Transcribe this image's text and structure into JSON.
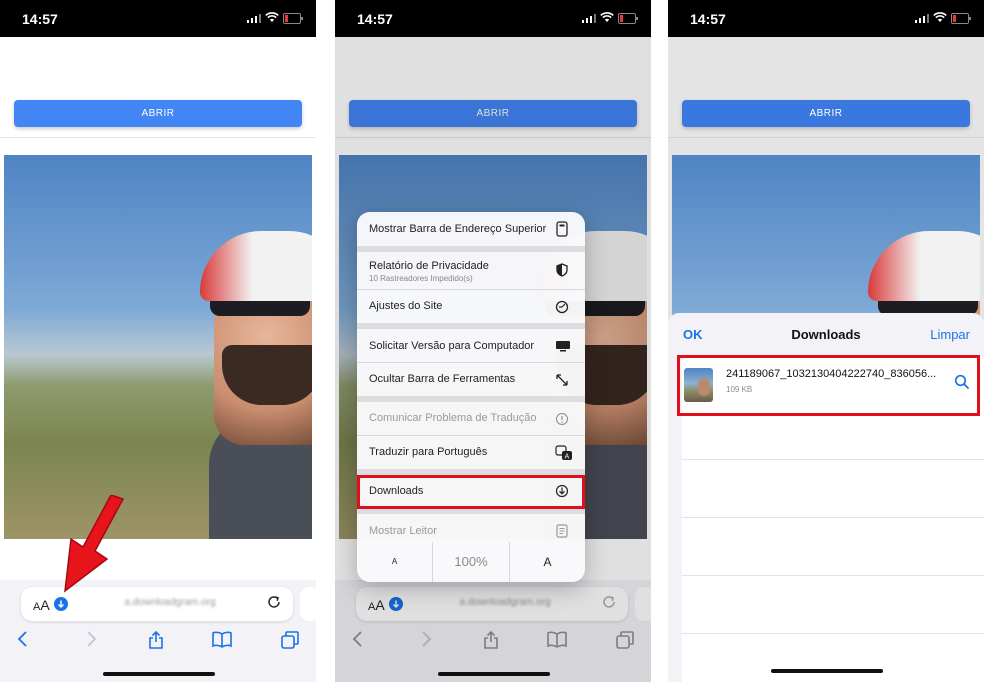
{
  "status": {
    "time": "14:57"
  },
  "page": {
    "open_button": "ABRIR"
  },
  "browser": {
    "text_size_small": "A",
    "text_size_large": "A",
    "url": "a.downloadgram.org"
  },
  "menu": {
    "items": [
      {
        "label": "Mostrar Barra de Endereço Superior",
        "icon": "top-address-bar-icon"
      },
      {
        "label": "Relatório de Privacidade",
        "sublabel": "10 Rastreadores Impedido(s)",
        "icon": "shield-icon"
      },
      {
        "label": "Ajustes do Site",
        "icon": "site-settings-icon"
      },
      {
        "label": "Solicitar Versão para Computador",
        "icon": "desktop-icon"
      },
      {
        "label": "Ocultar Barra de Ferramentas",
        "icon": "arrows-expand-icon"
      },
      {
        "label": "Comunicar Problema de Tradução",
        "icon": "exclamation-icon",
        "disabled": true
      },
      {
        "label": "Traduzir para Português",
        "icon": "translate-icon"
      },
      {
        "label": "Downloads",
        "icon": "download-icon",
        "highlighted": true
      },
      {
        "label": "Mostrar Leitor",
        "icon": "reader-icon",
        "disabled": true
      }
    ],
    "font_small": "A",
    "zoom": "100%",
    "font_large": "A"
  },
  "downloads": {
    "ok": "OK",
    "title": "Downloads",
    "clear": "Limpar",
    "file_name": "241189067_1032130404222740_836056...",
    "file_size": "109 KB"
  },
  "colors": {
    "accent": "#1a73e8",
    "highlight": "#e0101a",
    "button": "#4285f4"
  }
}
